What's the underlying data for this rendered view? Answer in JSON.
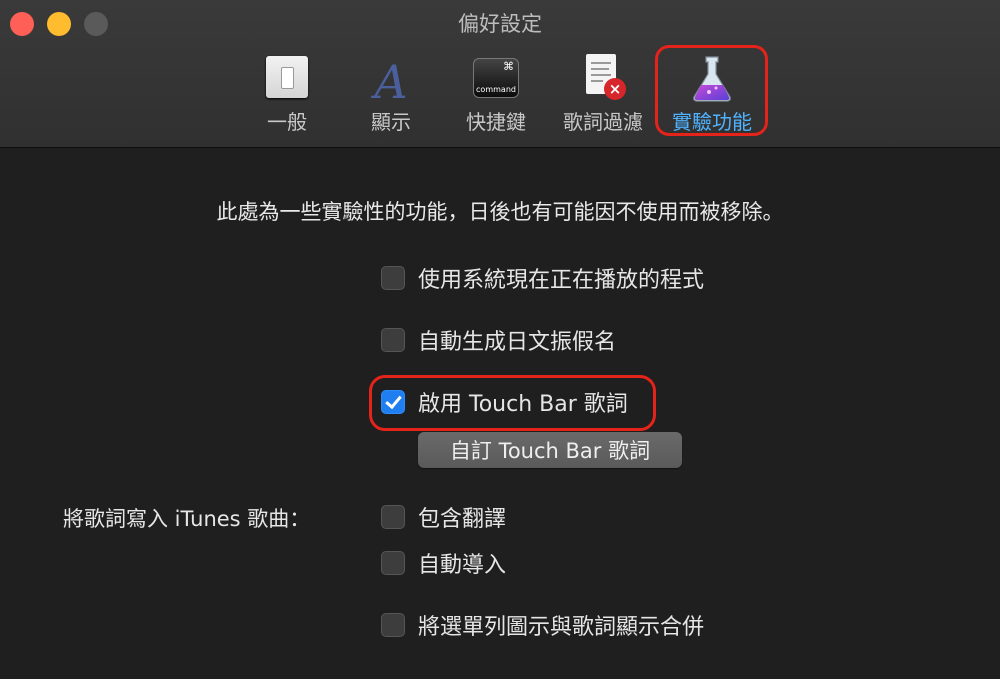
{
  "window": {
    "title": "偏好設定"
  },
  "toolbar": {
    "items": [
      {
        "label": "一般",
        "icon": "switch-icon"
      },
      {
        "label": "顯示",
        "icon": "font-a-icon"
      },
      {
        "label": "快捷鍵",
        "icon": "command-key-icon"
      },
      {
        "label": "歌詞過濾",
        "icon": "document-x-icon"
      },
      {
        "label": "實驗功能",
        "icon": "flask-icon",
        "selected": true
      }
    ],
    "command_key": {
      "symbol": "⌘",
      "word": "command"
    }
  },
  "main": {
    "intro": "此處為一些實驗性的功能，日後也有可能因不使用而被移除。",
    "options": [
      {
        "label": "使用系統現在正在播放的程式",
        "checked": false
      },
      {
        "label": "自動生成日文振假名",
        "checked": false
      },
      {
        "label": "啟用 Touch Bar 歌詞",
        "checked": true
      }
    ],
    "customize_button": "自訂 Touch Bar 歌詞",
    "itunes": {
      "label": "將歌詞寫入 iTunes 歌曲：",
      "options": [
        {
          "label": "包含翻譯",
          "checked": false
        },
        {
          "label": "自動導入",
          "checked": false
        }
      ]
    },
    "merge_option": {
      "label": "將選單列圖示與歌詞顯示合併",
      "checked": false
    }
  },
  "colors": {
    "accent": "#1f7ef0",
    "selected_tab": "#4fb3ff",
    "highlight": "#e4231a"
  }
}
